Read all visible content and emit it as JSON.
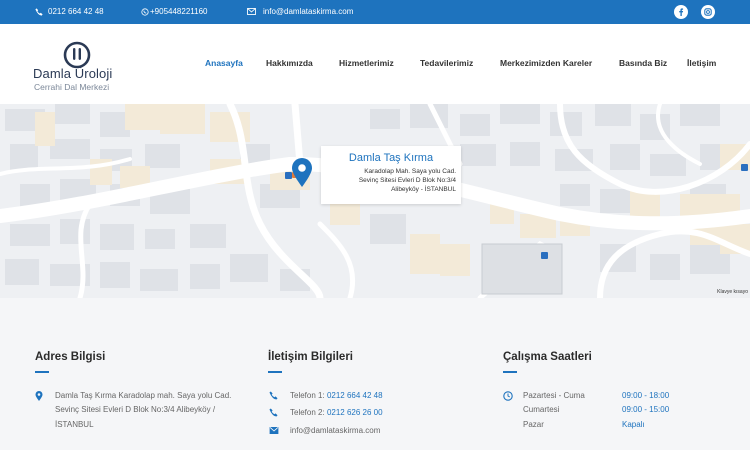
{
  "topbar": {
    "phone": "0212 664 42 48",
    "whatsapp": "+905448221160",
    "email": "info@damlataskirma.com"
  },
  "logo": {
    "title": "Damla Üroloji",
    "subtitle": "Cerrahi Dal Merkezi"
  },
  "nav": {
    "items": [
      "Anasayfa",
      "Hakkımızda",
      "Hizmetlerimiz",
      "Tedavilerimiz",
      "Merkezimizden Kareler",
      "Basında Biz",
      "İletişim"
    ],
    "active": "Anasayfa"
  },
  "map": {
    "card_title": "Damla Taş Kırma",
    "card_line1": "Karadolap Mah. Saya yolu Cad.",
    "card_line2": "Sevinç Sitesi Evleri D Blok No:3/4",
    "card_line3": "Alibeyköy - İSTANBUL",
    "attribution": "Klavye kısayo"
  },
  "footer": {
    "address": {
      "title": "Adres Bilgisi",
      "line1": "Damla Taş Kırma Karadolap mah. Saya yolu Cad.",
      "line2": "Sevinç Sitesi Evleri D Blok No:3/4 Alibeyköy /",
      "line3": "İSTANBUL"
    },
    "contact": {
      "title": "İletişim Bilgileri",
      "phone1_label": "Telefon 1:",
      "phone1": "0212 664 42 48",
      "phone2_label": "Telefon 2:",
      "phone2": "0212 626 26 00",
      "email": "info@damlataskirma.com"
    },
    "hours": {
      "title": "Çalışma Saatleri",
      "rows": [
        {
          "day": "Pazartesi - Cuma",
          "time": "09:00 - 18:00"
        },
        {
          "day": "Cumartesi",
          "time": "09:00 - 15:00"
        },
        {
          "day": "Pazar",
          "time": "Kapalı"
        }
      ]
    }
  },
  "colors": {
    "primary": "#1e73be",
    "footer_bg": "#f5f6f8",
    "map_bg": "#eef0f3"
  }
}
